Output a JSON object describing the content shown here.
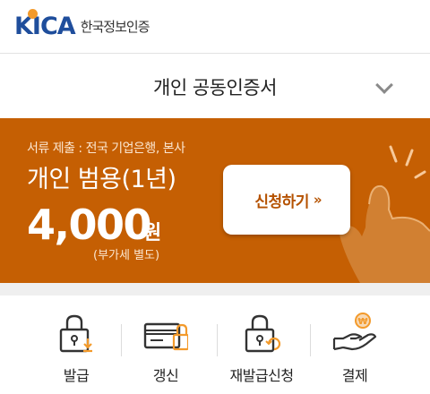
{
  "header": {
    "logo_mark": "KICA",
    "logo_text": "한국정보인증"
  },
  "product": {
    "title": "개인 공동인증서"
  },
  "banner": {
    "submit_note": "서류 제출 : 전국 기업은행, 본사",
    "plan_name": "개인 범용(1년)",
    "price": "4,000",
    "price_unit": "원",
    "vat_note": "(부가세 별도)",
    "apply_label": "신청하기",
    "apply_arrows": "»",
    "background_color": "#c55f03"
  },
  "menu": {
    "items": [
      {
        "label": "발급",
        "icon": "lock-download-icon"
      },
      {
        "label": "갱신",
        "icon": "card-lock-icon"
      },
      {
        "label": "재발급신청",
        "icon": "lock-refresh-icon"
      },
      {
        "label": "결제",
        "icon": "hand-coin-icon"
      }
    ]
  },
  "colors": {
    "brand_blue": "#1f4e9c",
    "accent_orange": "#f39a2b",
    "banner_orange": "#c55f03"
  }
}
